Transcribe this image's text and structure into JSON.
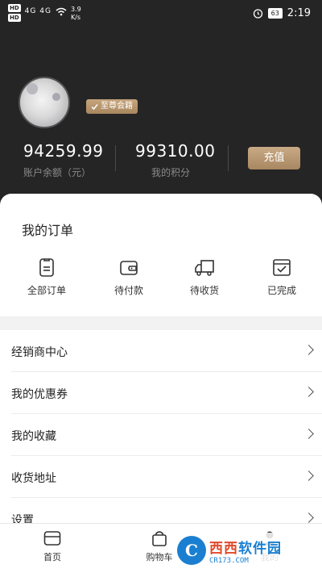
{
  "status_bar": {
    "hd_1": "HD",
    "hd_2": "HD",
    "signal": "4G  4G",
    "speed": "3.9\nK/s",
    "battery": "63",
    "time": "2:19"
  },
  "profile": {
    "badge": "至尊会籍",
    "balance_value": "94259.99",
    "balance_label": "账户余额（元）",
    "points_value": "99310.00",
    "points_label": "我的积分",
    "recharge_label": "充值"
  },
  "orders": {
    "title": "我的订单",
    "items": [
      {
        "label": "全部订单",
        "icon": "clipboard-icon"
      },
      {
        "label": "待付款",
        "icon": "wallet-icon"
      },
      {
        "label": "待收货",
        "icon": "truck-icon"
      },
      {
        "label": "已完成",
        "icon": "calendar-check-icon"
      }
    ]
  },
  "menu": {
    "items": [
      {
        "label": "经销商中心"
      },
      {
        "label": "我的优惠券"
      },
      {
        "label": "我的收藏"
      },
      {
        "label": "收货地址"
      },
      {
        "label": "设置"
      }
    ]
  },
  "bottom_nav": {
    "items": [
      {
        "label": "首页",
        "icon": "card-icon"
      },
      {
        "label": "购物车",
        "icon": "bag-icon"
      },
      {
        "label": "我的",
        "icon": "user-icon"
      }
    ]
  },
  "watermark": {
    "logo": "C",
    "main_red": "西西",
    "main_blue": "软件园",
    "sub": "CR173.COM"
  },
  "colors": {
    "header_bg": "#252525",
    "gold": "#b8966c"
  }
}
